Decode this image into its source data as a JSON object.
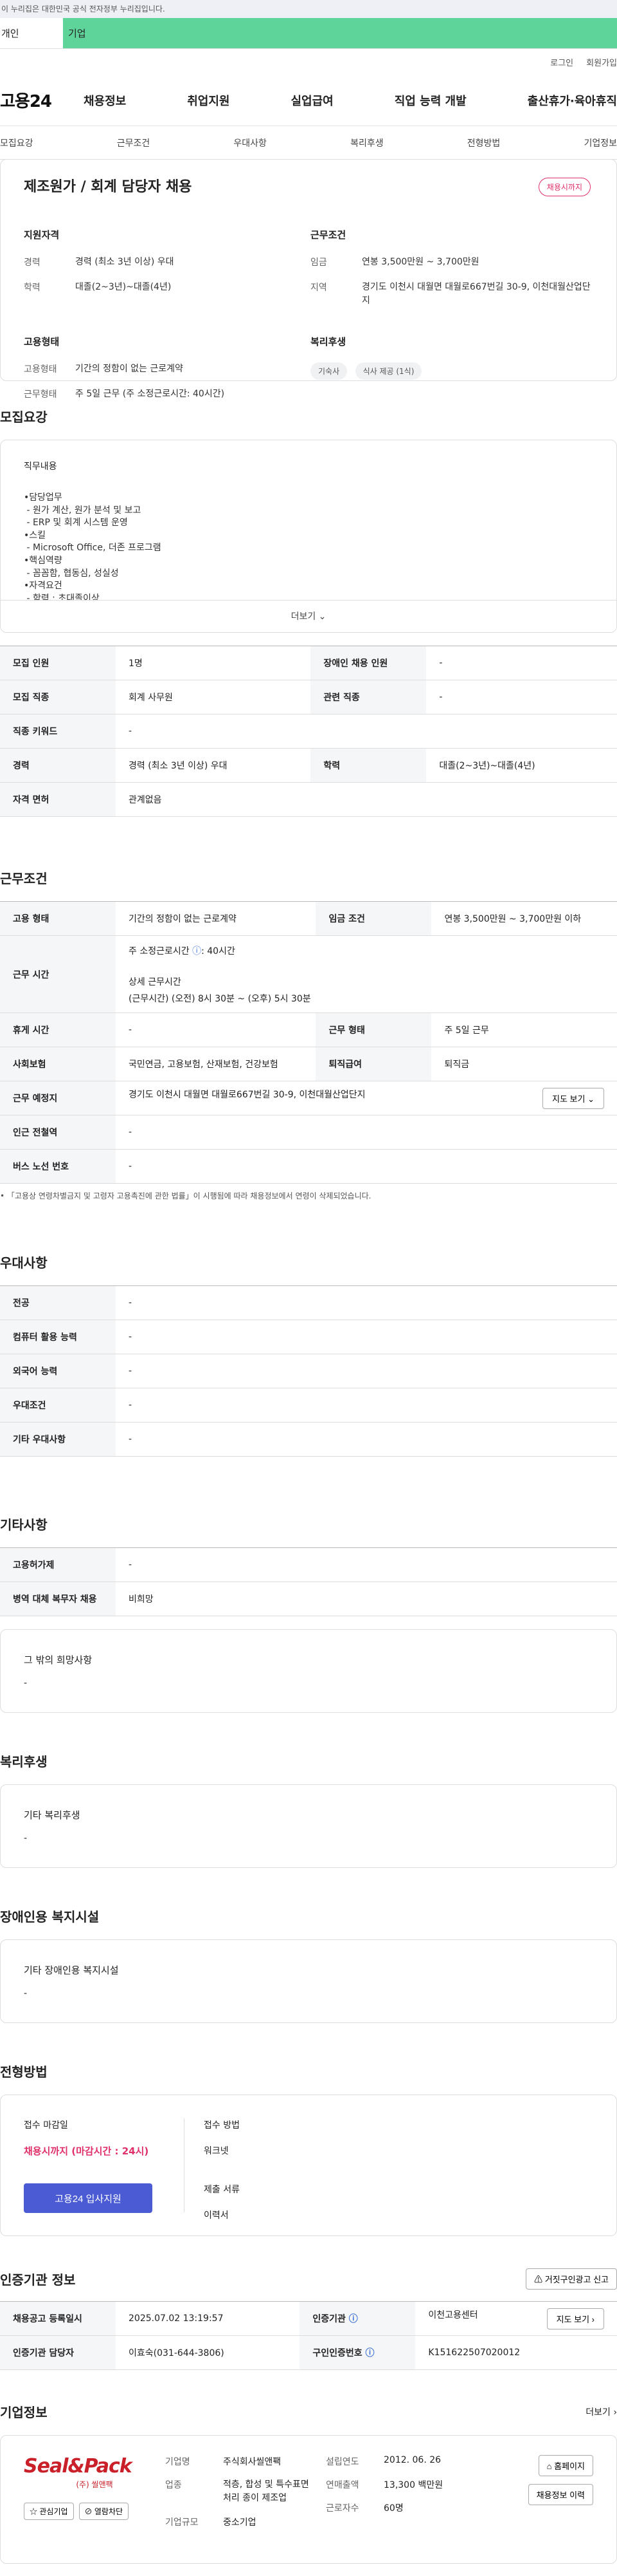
{
  "gov_banner": "이 누리집은 대한민국 공식 전자정부 누리집입니다.",
  "tabs": {
    "personal": "개인",
    "company": "기업"
  },
  "utility": {
    "login": "로그인",
    "signup": "회원가입"
  },
  "gnb": {
    "logo": "고용24",
    "menu": [
      "채용정보",
      "취업지원",
      "실업급여",
      "직업 능력 개발",
      "출산휴가·육아휴직"
    ]
  },
  "anchors": [
    "모집요강",
    "근무조건",
    "우대사항",
    "복리후생",
    "전형방법",
    "기업정보"
  ],
  "summary": {
    "title": "제조원가 / 회계 담당자 채용",
    "status": "채용시까지",
    "qual_heading": "지원자격",
    "qual": [
      {
        "k": "경력",
        "v": "경력 (최소 3년 이상) 우대"
      },
      {
        "k": "학력",
        "v": "대졸(2~3년)~대졸(4년)"
      }
    ],
    "cond_heading": "근무조건",
    "cond": [
      {
        "k": "임금",
        "v": "연봉 3,500만원 ~ 3,700만원"
      },
      {
        "k": "지역",
        "v": "경기도 이천시 대월면 대월로667번길 30-9, 이천대월산업단지"
      }
    ],
    "emp_heading": "고용형태",
    "emp": [
      {
        "k": "고용형태",
        "v": "기간의 정함이 없는 근로계약"
      },
      {
        "k": "근무형태",
        "v": "주 5일 근무 (주 소정근로시간: 40시간)"
      }
    ],
    "welfare_heading": "복리후생",
    "welfare_chips": [
      "기숙사",
      "식사 제공 (1식)"
    ]
  },
  "recruit": {
    "section_title": "모집요강",
    "duty_heading": "직무내용",
    "duty_lines": [
      "•담당업무",
      " - 원가 계산, 원가 분석 및 보고",
      " - ERP 및 회계 시스템 운영",
      "•스킬",
      " - Microsoft Office, 더존 프로그램",
      "•핵심역량",
      " - 꼼꼼함, 협동심, 성실성",
      "•자격요건",
      " - 학력 : 초대졸이상"
    ],
    "more_label": "더보기",
    "rows": [
      [
        {
          "h": "모집 인원",
          "v": "1명"
        },
        {
          "h": "장애인 채용 인원",
          "v": "-"
        }
      ],
      [
        {
          "h": "모집 직종",
          "v": "회계 사무원"
        },
        {
          "h": "관련 직종",
          "v": "-"
        }
      ],
      [
        {
          "h": "직종 키워드",
          "v": "-"
        }
      ],
      [
        {
          "h": "경력",
          "v": "경력 (최소 3년 이상) 우대"
        },
        {
          "h": "학력",
          "v": "대졸(2~3년)~대졸(4년)"
        }
      ],
      [
        {
          "h": "자격 면허",
          "v": "관계없음"
        }
      ]
    ]
  },
  "work": {
    "section_title": "근무조건",
    "emp_type_h": "고용 형태",
    "emp_type_v": "기간의 정함이 없는 근로계약",
    "wage_h": "임금 조건",
    "wage_v": "연봉 3,500만원 ~ 3,700만원 이하",
    "hours_h": "근무 시간",
    "hours_week": "주 소정근로시간",
    "hours_week_v": ": 40시간",
    "hours_detail_h": "상세 근무시간",
    "hours_detail_v": "(근무시간) (오전) 8시 30분 ~ (오후) 5시 30분",
    "break_h": "휴게 시간",
    "break_v": "-",
    "form_h": "근무 형태",
    "form_v": "주 5일 근무",
    "insure_h": "사회보험",
    "insure_v": "국민연금, 고용보험, 산재보험, 건강보험",
    "retire_h": "퇴직급여",
    "retire_v": "퇴직금",
    "place_h": "근무 예정지",
    "place_v": "경기도 이천시 대월면 대월로667번길 30-9, 이천대월산업단지",
    "map_btn": "지도 보기",
    "subway_h": "인근 전철역",
    "subway_v": "-",
    "bus_h": "버스 노선 번호",
    "bus_v": "-",
    "notice": "「고용상 연령차별금지 및 고령자 고용촉진에 관한 법률」이 시행됨에 따라 채용정보에서 연령이 삭제되었습니다."
  },
  "pref": {
    "section_title": "우대사항",
    "rows": [
      {
        "h": "전공",
        "v": "-"
      },
      {
        "h": "컴퓨터 활용 능력",
        "v": "-"
      },
      {
        "h": "외국어 능력",
        "v": "-"
      },
      {
        "h": "우대조건",
        "v": "-"
      },
      {
        "h": "기타 우대사항",
        "v": "-"
      }
    ]
  },
  "etc": {
    "section_title": "기타사항",
    "rows": [
      {
        "h": "고용허가제",
        "v": "-"
      },
      {
        "h": "병역 대체 복무자 채용",
        "v": "비희망"
      }
    ],
    "box_h": "그 밖의 희망사항",
    "box_v": "-"
  },
  "welfare": {
    "section_title": "복리후생",
    "box_h": "기타 복리후생",
    "box_v": "-"
  },
  "disabled": {
    "section_title": "장애인용 복지시설",
    "box_h": "기타 장애인용 복지시설",
    "box_v": "-"
  },
  "apply": {
    "section_title": "전형방법",
    "deadline_h": "접수 마감일",
    "deadline_v": "채용시까지 (마감시간 : 24시)",
    "apply_btn": "고용24 입사지원",
    "method_h": "접수 방법",
    "method_v": "워크넷",
    "docs_h": "제출 서류",
    "docs_v": "이력서"
  },
  "agency": {
    "section_title": "인증기관 정보",
    "report_btn": "거짓구인광고 신고",
    "reg_h": "채용공고 등록일시",
    "reg_v": "2025.07.02 13:19:57",
    "org_h": "인증기관",
    "org_v": "이천고용센터",
    "map_btn": "지도 보기",
    "mgr_h": "인증기관 담당자",
    "mgr_v": "이효숙(031-644-3806)",
    "no_h": "구인인증번호",
    "no_v": "K151622507020012"
  },
  "company": {
    "section_title": "기업정보",
    "more": "더보기",
    "logo_text": "Seal&Pack",
    "logo_sub": "(주) 씰앤팩",
    "fav_btn": "관심기업",
    "block_btn": "열람차단",
    "name_h": "기업명",
    "name_v": "주식회사씰앤팩",
    "industry_h": "업종",
    "industry_v": "적층, 합성 및 특수표면처리 종이 제조업",
    "size_h": "기업규모",
    "size_v": "중소기업",
    "founded_h": "설립연도",
    "founded_v": "2012. 06. 26",
    "sales_h": "연매출액",
    "sales_v": "13,300 백만원",
    "staff_h": "근로자수",
    "staff_v": "60명",
    "home_btn": "홈페이지",
    "jobs_btn": "채용정보 이력"
  }
}
